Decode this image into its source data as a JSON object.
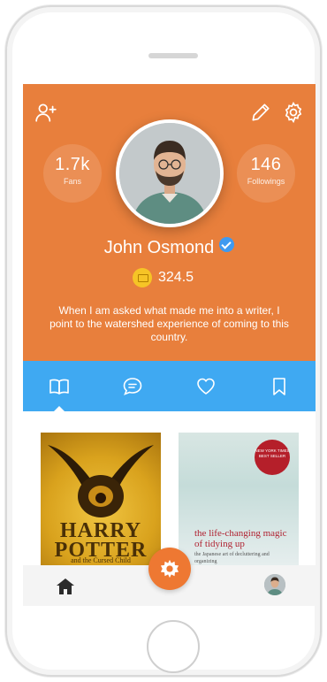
{
  "profile": {
    "name": "John Osmond",
    "verified": true,
    "coins": "324.5",
    "bio": "When I am asked what made me into a writer, I point to the watershed experience of coming to this country.",
    "stats": {
      "fans": {
        "value": "1.7k",
        "label": "Fans"
      },
      "followings": {
        "value": "146",
        "label": "Followings"
      }
    },
    "actions": [
      "add-user-icon",
      "edit-icon",
      "settings-icon"
    ]
  },
  "tabs": [
    {
      "icon": "book-icon",
      "active": true
    },
    {
      "icon": "chat-icon",
      "active": false
    },
    {
      "icon": "heart-icon",
      "active": false
    },
    {
      "icon": "bookmark-icon",
      "active": false
    }
  ],
  "books": [
    {
      "title_line1": "HARRY",
      "title_line2": "POTTER",
      "subtitle": "and the Cursed Child"
    },
    {
      "badge": "NEW YORK TIMES BEST SELLER",
      "title": "the life-changing magic of tidying up",
      "subtitle": "the Japanese art of decluttering and organizing"
    }
  ],
  "bottom_nav": [
    "home-icon",
    "gear-icon",
    "profile-avatar"
  ],
  "colors": {
    "header": "#e87f3c",
    "tabbar": "#3fa9f2",
    "accent": "#ee7832",
    "verified": "#3f9af0"
  }
}
